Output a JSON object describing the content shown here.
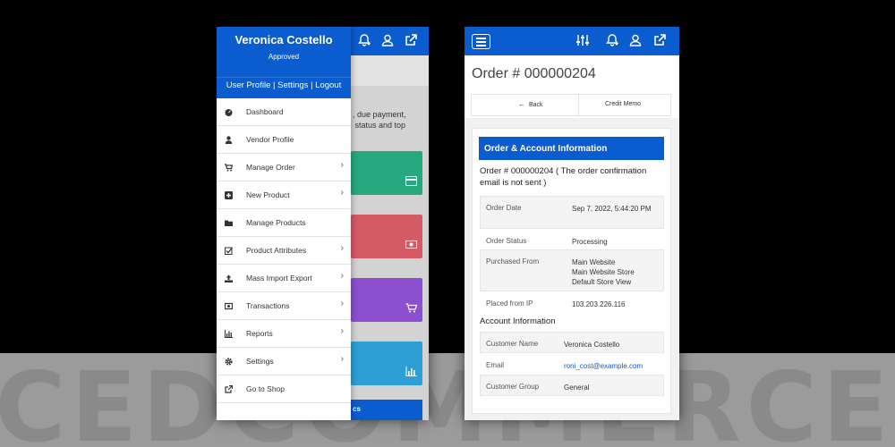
{
  "watermark": "CEDCOMMERCE",
  "colors": {
    "primary": "#0a5ccf",
    "green": "#28a87e",
    "red": "#d45a66",
    "purple": "#8b4fd0",
    "cyan": "#2d9fd5"
  },
  "left_phone": {
    "vendor_name": "Veronica Costello",
    "vendor_status": "Approved",
    "links": "User Profile | Settings | Logout",
    "header_icons": [
      "bell-icon",
      "user-icon",
      "external-link-icon"
    ],
    "background_text": ", due payment,\n status and top",
    "bottom_tile_text": "cs",
    "menu": [
      {
        "label": "Dashboard",
        "icon": "dashboard-icon",
        "submenu": false
      },
      {
        "label": "Vendor Profile",
        "icon": "user-icon",
        "submenu": false
      },
      {
        "label": "Manage Order",
        "icon": "cart-icon",
        "submenu": true
      },
      {
        "label": "New Product",
        "icon": "plus-square-icon",
        "submenu": true
      },
      {
        "label": "Manage Products",
        "icon": "folder-icon",
        "submenu": false
      },
      {
        "label": "Product Attributes",
        "icon": "checkbox-icon",
        "submenu": true
      },
      {
        "label": "Mass Import Export",
        "icon": "upload-icon",
        "submenu": true
      },
      {
        "label": "Transactions",
        "icon": "money-icon",
        "submenu": true
      },
      {
        "label": "Reports",
        "icon": "bar-chart-icon",
        "submenu": true
      },
      {
        "label": "Settings",
        "icon": "gear-icon",
        "submenu": true
      },
      {
        "label": "Go to Shop",
        "icon": "external-link-icon",
        "submenu": false
      }
    ],
    "chevron": "›"
  },
  "right_phone": {
    "header_icons": [
      "sliders-icon",
      "bell-icon",
      "user-icon",
      "external-link-icon"
    ],
    "page_title": "Order # 000000204",
    "back_arrow": "←",
    "back_label": "Back",
    "credit_memo_label": "Credit Memo",
    "card_title": "Order & Account Information",
    "order_line": "Order # 000000204 ( The order confirmation email is not sent )",
    "order_fields": [
      {
        "key": "Order Date",
        "value": "Sep 7, 2022, 5:44:20 PM"
      },
      {
        "key": "Order Status",
        "value": "Processing"
      },
      {
        "key": "Purchased From",
        "value": "Main Website\nMain Website Store\nDefault Store View"
      },
      {
        "key": "Placed from IP",
        "value": "103.203.226.116"
      }
    ],
    "account_label": "Account Information",
    "account_fields": [
      {
        "key": "Customer Name",
        "value": "Veronica Costello"
      },
      {
        "key": "Email",
        "value": "roni_cost@example.com"
      },
      {
        "key": "Customer Group",
        "value": "General"
      }
    ]
  }
}
